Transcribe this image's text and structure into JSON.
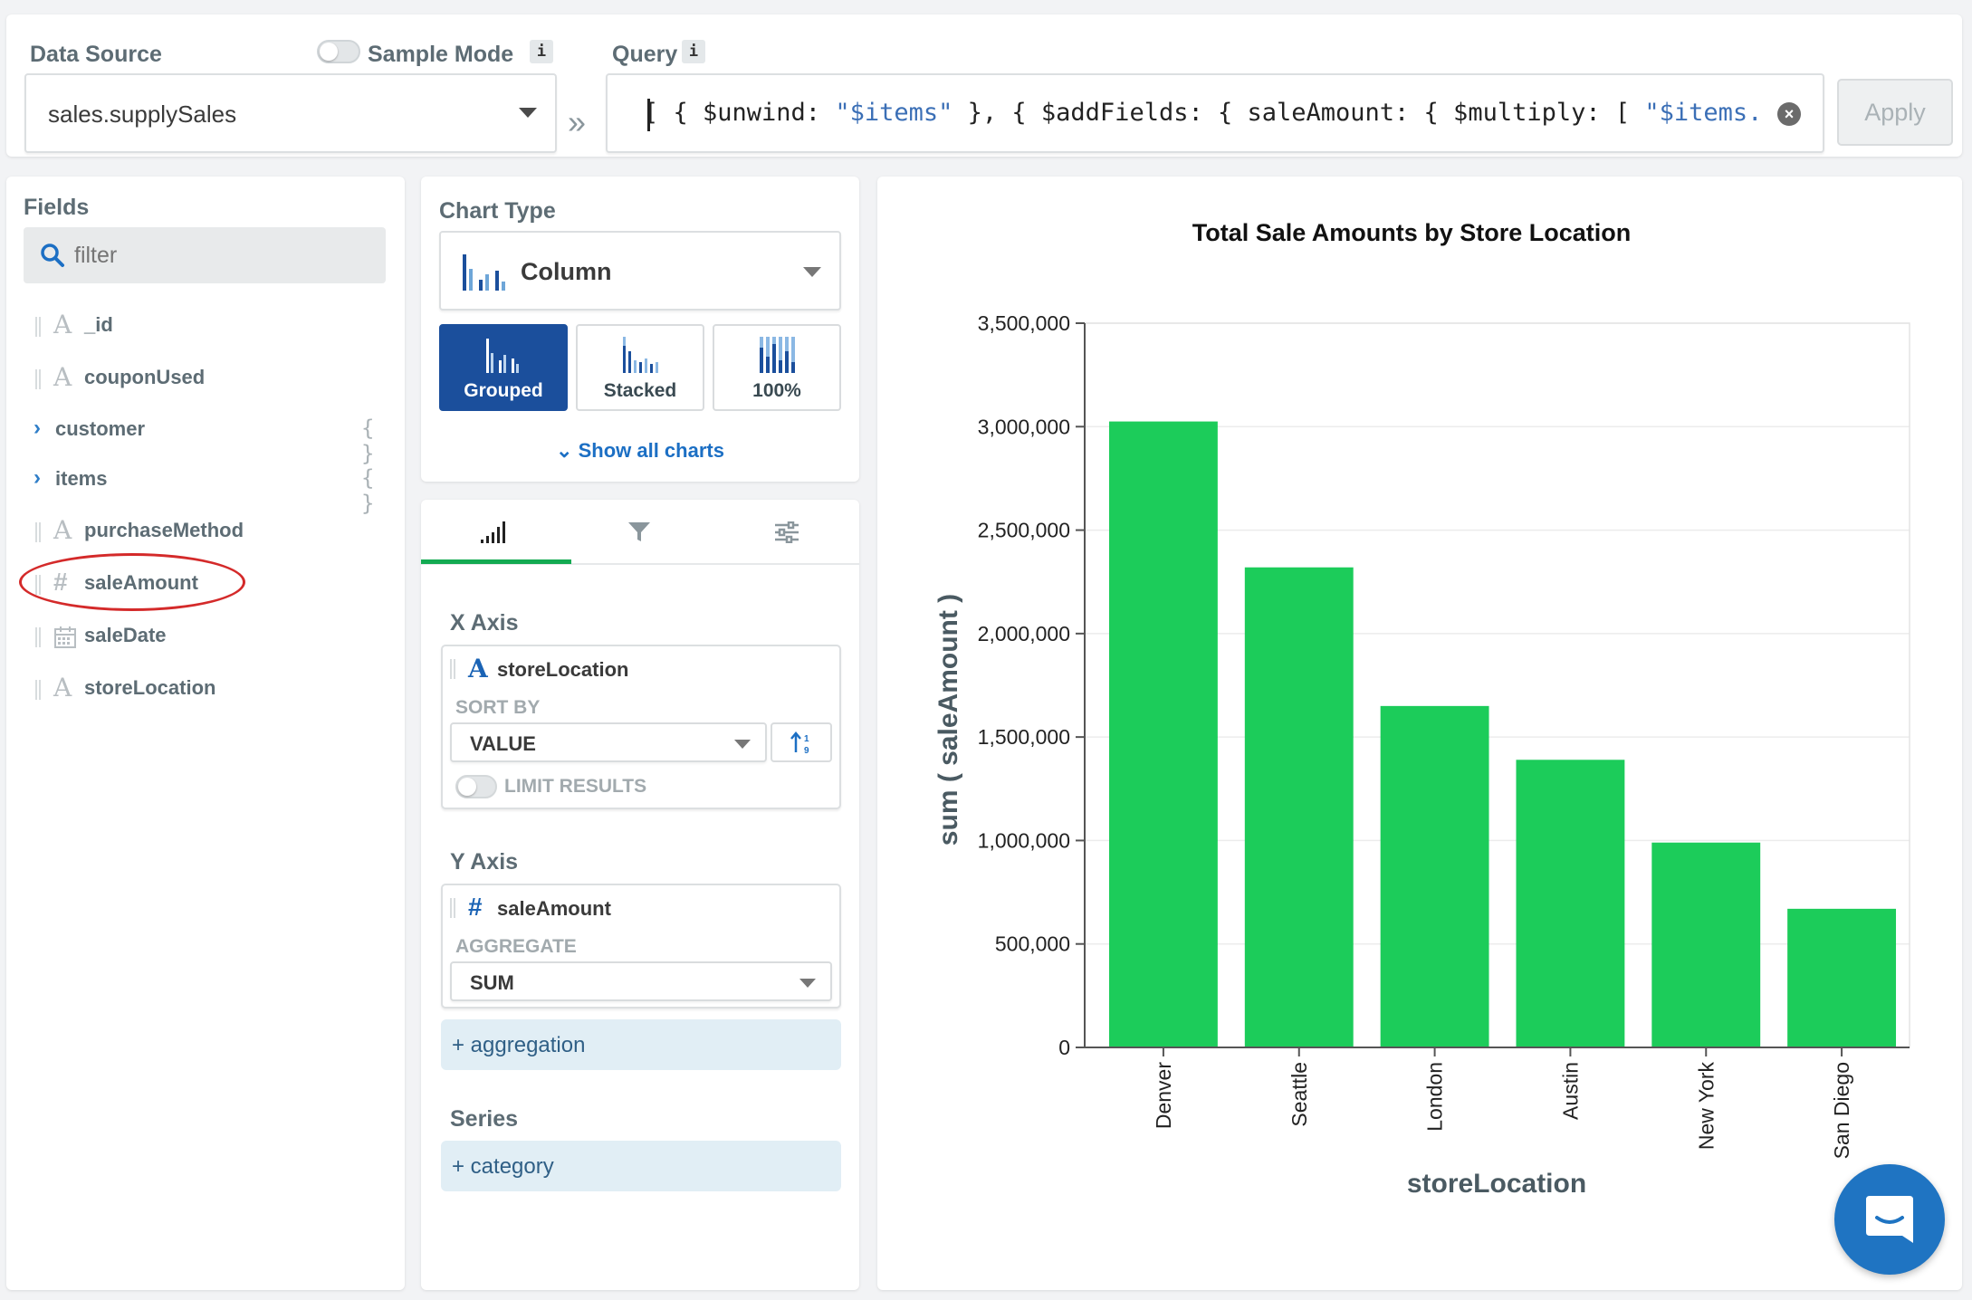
{
  "top_bar": {
    "data_source_label": "Data Source",
    "sample_mode_label": "Sample Mode",
    "info_badge": "i",
    "data_source_value": "sales.supplySales",
    "chevron": "»",
    "query_label": "Query",
    "query_parts": {
      "p1": "[ { $unwind: ",
      "s1": "\"$items\"",
      "p2": " }, { $addFields: { saleAmount: { $multiply: [ ",
      "s2": "\"$items.pri"
    },
    "clear_icon": "×",
    "apply_label": "Apply"
  },
  "fields_panel": {
    "title": "Fields",
    "filter_placeholder": "filter",
    "fields": [
      {
        "name": "_id",
        "type": "string",
        "icon": "A"
      },
      {
        "name": "couponUsed",
        "type": "string",
        "icon": "A"
      },
      {
        "name": "customer",
        "type": "object",
        "icon": "{ }"
      },
      {
        "name": "items",
        "type": "object",
        "icon": "{ }"
      },
      {
        "name": "purchaseMethod",
        "type": "string",
        "icon": "A"
      },
      {
        "name": "saleAmount",
        "type": "number",
        "icon": "#"
      },
      {
        "name": "saleDate",
        "type": "date",
        "icon": "calendar-icon"
      },
      {
        "name": "storeLocation",
        "type": "string",
        "icon": "A"
      }
    ],
    "expand_icon": "›"
  },
  "chart_type": {
    "title": "Chart Type",
    "selected": "Column",
    "variants": [
      "Grouped",
      "Stacked",
      "100%"
    ],
    "active_variant": "Grouped",
    "show_all": "Show all charts"
  },
  "encode": {
    "tabs": [
      "encode-tab",
      "filter-tab",
      "customize-tab"
    ],
    "x_axis": {
      "title": "X Axis",
      "field_icon": "A",
      "field": "storeLocation",
      "sort_by_label": "SORT BY",
      "sort_value": "VALUE",
      "limit_label": "LIMIT RESULTS"
    },
    "y_axis": {
      "title": "Y Axis",
      "field_icon": "#",
      "field": "saleAmount",
      "aggregate_label": "AGGREGATE",
      "aggregate_value": "SUM"
    },
    "add_aggregation": "+ aggregation",
    "series_title": "Series",
    "add_category": "+ category"
  },
  "colors": {
    "bar": "#1ccc5a",
    "accent_blue": "#1b4f9c",
    "tab_green": "#13aa52",
    "highlight_red": "#d42a2a"
  },
  "chart_data": {
    "type": "bar",
    "title": "Total Sale Amounts by Store Location",
    "xlabel": "storeLocation",
    "ylabel": "sum ( saleAmount )",
    "categories": [
      "Denver",
      "Seattle",
      "London",
      "Austin",
      "New York",
      "San Diego"
    ],
    "values": [
      3025000,
      2320000,
      1650000,
      1390000,
      990000,
      670000
    ],
    "ylim": [
      0,
      3500000
    ],
    "yticks": [
      0,
      500000,
      1000000,
      1500000,
      2000000,
      2500000,
      3000000,
      3500000
    ],
    "ytick_labels": [
      "0",
      "500,000",
      "1,000,000",
      "1,500,000",
      "2,000,000",
      "2,500,000",
      "3,000,000",
      "3,500,000"
    ],
    "grid": true,
    "legend": "none"
  }
}
